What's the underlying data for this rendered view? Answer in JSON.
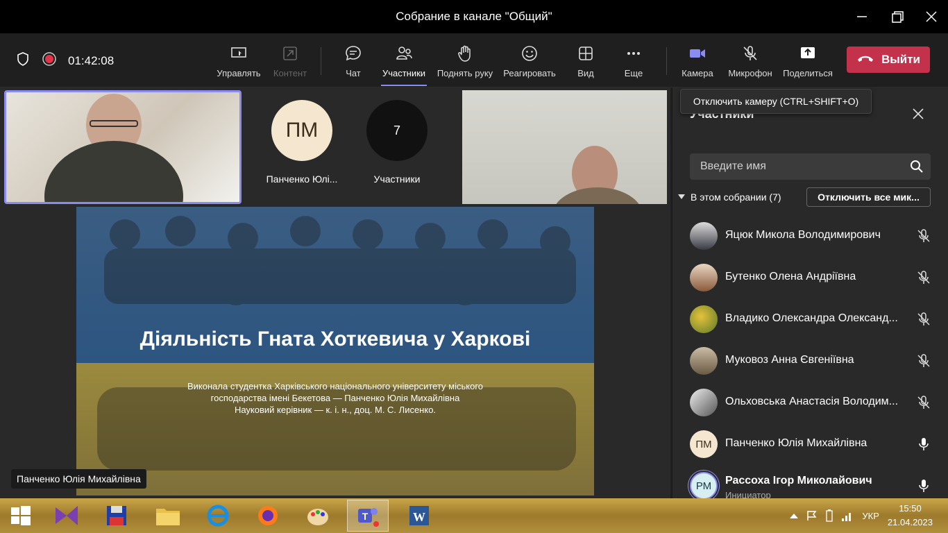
{
  "window": {
    "title": "Собрание в канале \"Общий\""
  },
  "toolbar": {
    "timer": "01:42:08",
    "buttons": {
      "manage": "Управлять",
      "content": "Контент",
      "chat": "Чат",
      "participants": "Участники",
      "raise_hand": "Поднять руку",
      "react": "Реагировать",
      "view": "Вид",
      "more": "Еще",
      "camera": "Камера",
      "mic": "Микрофон",
      "share": "Поделиться",
      "leave": "Выйти"
    }
  },
  "tooltip": "Отключить камеру (CTRL+SHIFT+O)",
  "stage": {
    "tiles": [
      {
        "initials": "ПМ",
        "name": "Панченко Юлі..."
      },
      {
        "initials": "7",
        "name": "Участники"
      }
    ],
    "speaker_tag": "Панченко Юлія Михайлівна",
    "slide": {
      "title": "Діяльність Гната Хоткевича у Харкові",
      "lines": [
        "Виконала студентка Харківського національного університету міського",
        "господарства імені Бекетова — Панченко Юлія Михайлівна",
        "Науковий керівник — к. і. н., доц. М. С. Лисенко."
      ]
    }
  },
  "panel": {
    "title": "Участники",
    "search_placeholder": "Введите имя",
    "section_label": "В этом собрании (7)",
    "mute_all": "Отключить все мик...",
    "participants": [
      {
        "name": "Яцюк Микола Володимирович",
        "initials": "",
        "role": "",
        "mic": "muted"
      },
      {
        "name": "Бутенко Олена Андріївна",
        "initials": "",
        "role": "",
        "mic": "muted"
      },
      {
        "name": "Владико Олександра Олександ...",
        "initials": "",
        "role": "",
        "mic": "muted"
      },
      {
        "name": "Муковоз Анна Євгеніївна",
        "initials": "",
        "role": "",
        "mic": "muted"
      },
      {
        "name": "Ольховська Анастасія Володим...",
        "initials": "",
        "role": "",
        "mic": "muted"
      },
      {
        "name": "Панченко Юлія Михайлівна",
        "initials": "ПМ",
        "role": "",
        "mic": "on"
      },
      {
        "name": "Рассоха Ігор Миколайович",
        "initials": "РМ",
        "role": "Инициатор",
        "mic": "on"
      }
    ]
  },
  "taskbar": {
    "lang": "УКР",
    "time": "15:50",
    "date": "21.04.2023"
  },
  "colors": {
    "accent": "#8b8cf0",
    "leave": "#c4314b",
    "record": "#e3354a"
  }
}
